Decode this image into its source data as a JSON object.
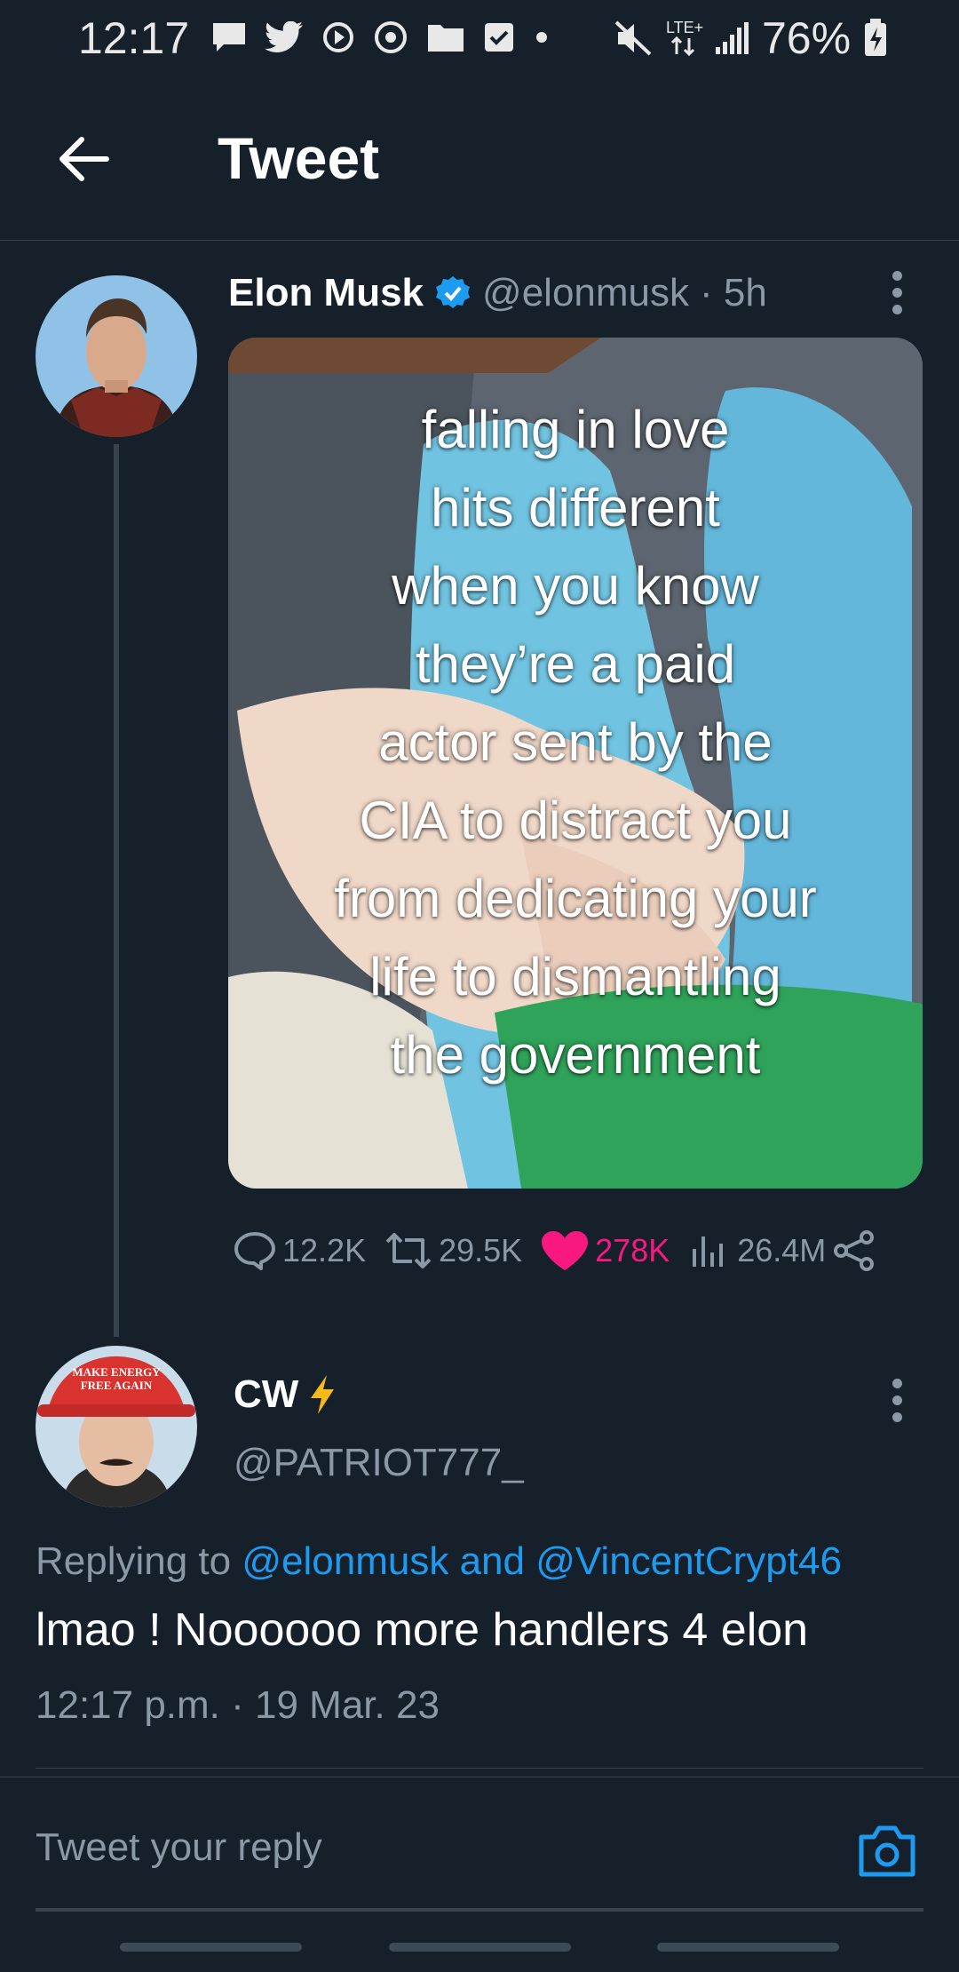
{
  "status_bar": {
    "time": "12:17",
    "network": "LTE+",
    "battery": "76%"
  },
  "header": {
    "title": "Tweet"
  },
  "tweet": {
    "author_name": "Elon Musk",
    "author_handle": "@elonmusk",
    "age": "· 5h",
    "verified": true,
    "media_text": "falling in love\nhits different\nwhen you know\nthey’re a paid\nactor sent by the\nCIA to distract you\nfrom dedicating your\nlife to dismantling\nthe government",
    "stats": {
      "replies": "12.2K",
      "retweets": "29.5K",
      "likes": "278K",
      "views": "26.4M"
    }
  },
  "reply": {
    "author_name": "CW",
    "author_handle": "@PATRIOT777_",
    "replying_prefix": "Replying to",
    "replying_mentions": "@elonmusk and @VincentCrypt46",
    "text": "lmao ! Noooooo more handlers 4 elon",
    "timestamp": "12:17 p.m. · 19 Mar. 23",
    "hat_text": "MAKE ENERGY FREE AGAIN"
  },
  "composer": {
    "placeholder": "Tweet your reply"
  },
  "colors": {
    "background": "#15202b",
    "accent": "#1d9bf0",
    "like": "#f91880",
    "secondary_text": "#8b98a5"
  }
}
